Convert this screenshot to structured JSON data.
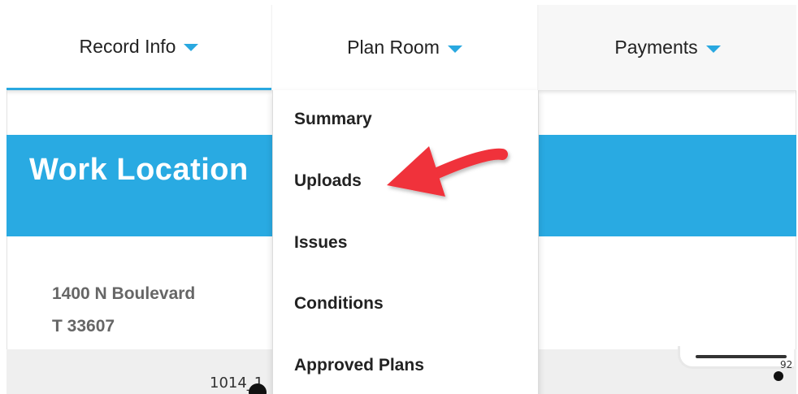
{
  "nav": {
    "tabs": [
      {
        "label": "Record Info"
      },
      {
        "label": "Plan Room"
      },
      {
        "label": "Payments"
      }
    ],
    "accent_color": "#29a8e0"
  },
  "banner": {
    "title": "Work Location",
    "color": "#29aae2"
  },
  "address": {
    "line1": "1400 N Boulevard",
    "line2": "T 33607"
  },
  "dropdown": {
    "items": [
      {
        "label": "Summary"
      },
      {
        "label": "Uploads"
      },
      {
        "label": "Issues"
      },
      {
        "label": "Conditions"
      },
      {
        "label": "Approved Plans"
      }
    ]
  },
  "bottom": {
    "left_label": "1014_1",
    "right_label": "92"
  },
  "annotation": {
    "arrow_color": "#f0313a",
    "points_to": "Uploads"
  }
}
